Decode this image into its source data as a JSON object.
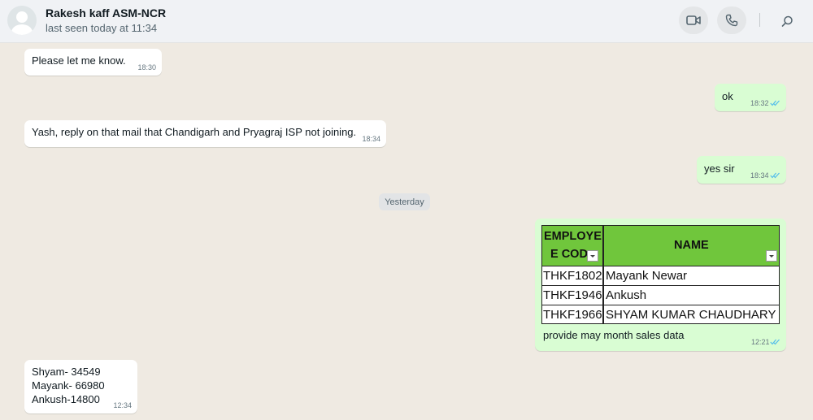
{
  "header": {
    "contact_name": "Rakesh kaff ASM-NCR",
    "last_seen": "last seen today at 11:34"
  },
  "messages": [
    {
      "direction": "incoming",
      "text": "Please let me know.",
      "time": "18:30"
    },
    {
      "direction": "outgoing",
      "text": "ok",
      "time": "18:32",
      "read": true
    },
    {
      "direction": "incoming",
      "text": "Yash, reply on that mail that Chandigarh and Pryagraj ISP not joining.",
      "time": "18:34"
    },
    {
      "direction": "outgoing",
      "text": "yes sir",
      "time": "18:34",
      "read": true
    },
    {
      "direction": "outgoing",
      "type": "image",
      "caption": "provide may month sales data",
      "time": "12:21",
      "read": true
    },
    {
      "direction": "incoming",
      "lines": [
        "Shyam- 34549",
        "Mayank- 66980",
        "Ankush-14800"
      ],
      "time": "12:34"
    }
  ],
  "date_divider": "Yesterday",
  "spreadsheet": {
    "headers": [
      "EMPLOYE",
      "E COD",
      "NAME"
    ],
    "rows": [
      [
        "THKF1802",
        "Mayank Newar"
      ],
      [
        "THKF1946",
        "Ankush"
      ],
      [
        "THKF1966",
        "SHYAM KUMAR CHAUDHARY"
      ]
    ]
  },
  "icons": [
    "video-call-icon",
    "voice-call-icon",
    "search-icon",
    "double-check-icon"
  ],
  "colors": {
    "outgoing_bubble": "#d9fdd3",
    "incoming_bubble": "#ffffff",
    "read_tick": "#53bdeb",
    "header_fill": "#70c63c",
    "chat_bg": "#efeae2"
  }
}
